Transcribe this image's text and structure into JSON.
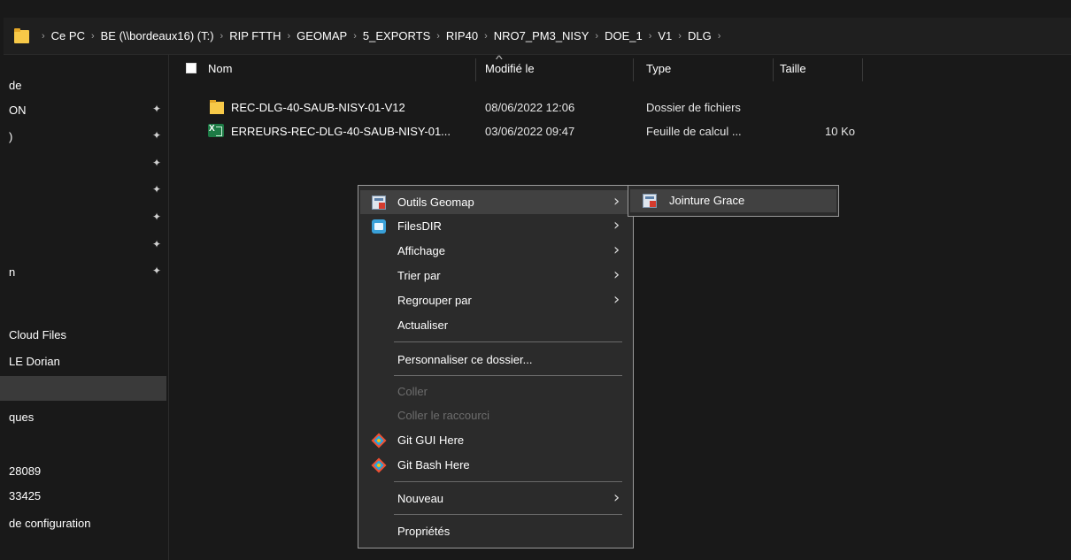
{
  "address_bar": {
    "breadcrumbs": [
      "Ce PC",
      "BE (\\\\bordeaux16) (T:)",
      "RIP FTTH",
      "GEOMAP",
      "5_EXPORTS",
      "RIP40",
      "NRO7_PM3_NISY",
      "DOE_1",
      "V1",
      "DLG"
    ],
    "separator": "›"
  },
  "sidebar": {
    "items": [
      {
        "label": "de",
        "pinned": false
      },
      {
        "label": "ON",
        "pinned": true
      },
      {
        "label": ")",
        "pinned": true
      },
      {
        "label": "",
        "pinned": true
      },
      {
        "label": "",
        "pinned": true
      },
      {
        "label": "",
        "pinned": true
      },
      {
        "label": "",
        "pinned": true
      },
      {
        "label": "n",
        "pinned": true
      },
      {
        "label": "",
        "pinned": false
      },
      {
        "label": "Cloud Files",
        "pinned": false
      },
      {
        "label": "LE Dorian",
        "pinned": false
      },
      {
        "label": "",
        "pinned": false,
        "selected": true
      },
      {
        "label": "ques",
        "pinned": false
      },
      {
        "label": "",
        "pinned": false
      },
      {
        "label": "28089",
        "pinned": false
      },
      {
        "label": "33425",
        "pinned": false
      },
      {
        "label": " de configuration",
        "pinned": false
      }
    ],
    "pin_glyph": "📌"
  },
  "columns": {
    "name": "Nom",
    "modified": "Modifié le",
    "type": "Type",
    "size": "Taille",
    "sort_glyph": "^"
  },
  "files": [
    {
      "name": "REC-DLG-40-SAUB-NISY-01-V12",
      "modified": "08/06/2022 12:06",
      "type": "Dossier de fichiers",
      "size": "",
      "icon": "folder-icon"
    },
    {
      "name": "ERREURS-REC-DLG-40-SAUB-NISY-01...",
      "modified": "03/06/2022 09:47",
      "type": "Feuille de calcul ...",
      "size": "10 Ko",
      "icon": "excel-file-icon"
    }
  ],
  "context_menu": {
    "items": [
      {
        "label": "Outils Geomap",
        "icon": "geomap-tool-icon",
        "submenu": true,
        "highlighted": true
      },
      {
        "label": "FilesDIR",
        "icon": "filesdir-icon",
        "submenu": true
      },
      {
        "label": "Affichage",
        "icon": "",
        "submenu": true
      },
      {
        "label": "Trier par",
        "icon": "",
        "submenu": true
      },
      {
        "label": "Regrouper par",
        "icon": "",
        "submenu": true
      },
      {
        "label": "Actualiser",
        "icon": "",
        "submenu": false
      },
      {
        "label": "Personnaliser ce dossier...",
        "icon": "",
        "submenu": false
      },
      {
        "label": "Coller",
        "icon": "",
        "submenu": false,
        "disabled": true
      },
      {
        "label": "Coller le raccourci",
        "icon": "",
        "submenu": false,
        "disabled": true
      },
      {
        "label": "Git GUI Here",
        "icon": "git-icon",
        "submenu": false
      },
      {
        "label": "Git Bash Here",
        "icon": "git-icon",
        "submenu": false
      },
      {
        "label": "Nouveau",
        "icon": "",
        "submenu": true
      },
      {
        "label": "Propriétés",
        "icon": "",
        "submenu": false
      }
    ],
    "arrow_glyph": "›"
  },
  "submenu": {
    "items": [
      {
        "label": "Jointure Grace",
        "icon": "geomap-tool-icon"
      }
    ]
  },
  "colors": {
    "background": "#191919",
    "menu_bg": "#2b2b2b",
    "menu_highlight": "#414141",
    "folder_yellow": "#f7c948",
    "excel_green": "#1d7a45"
  }
}
